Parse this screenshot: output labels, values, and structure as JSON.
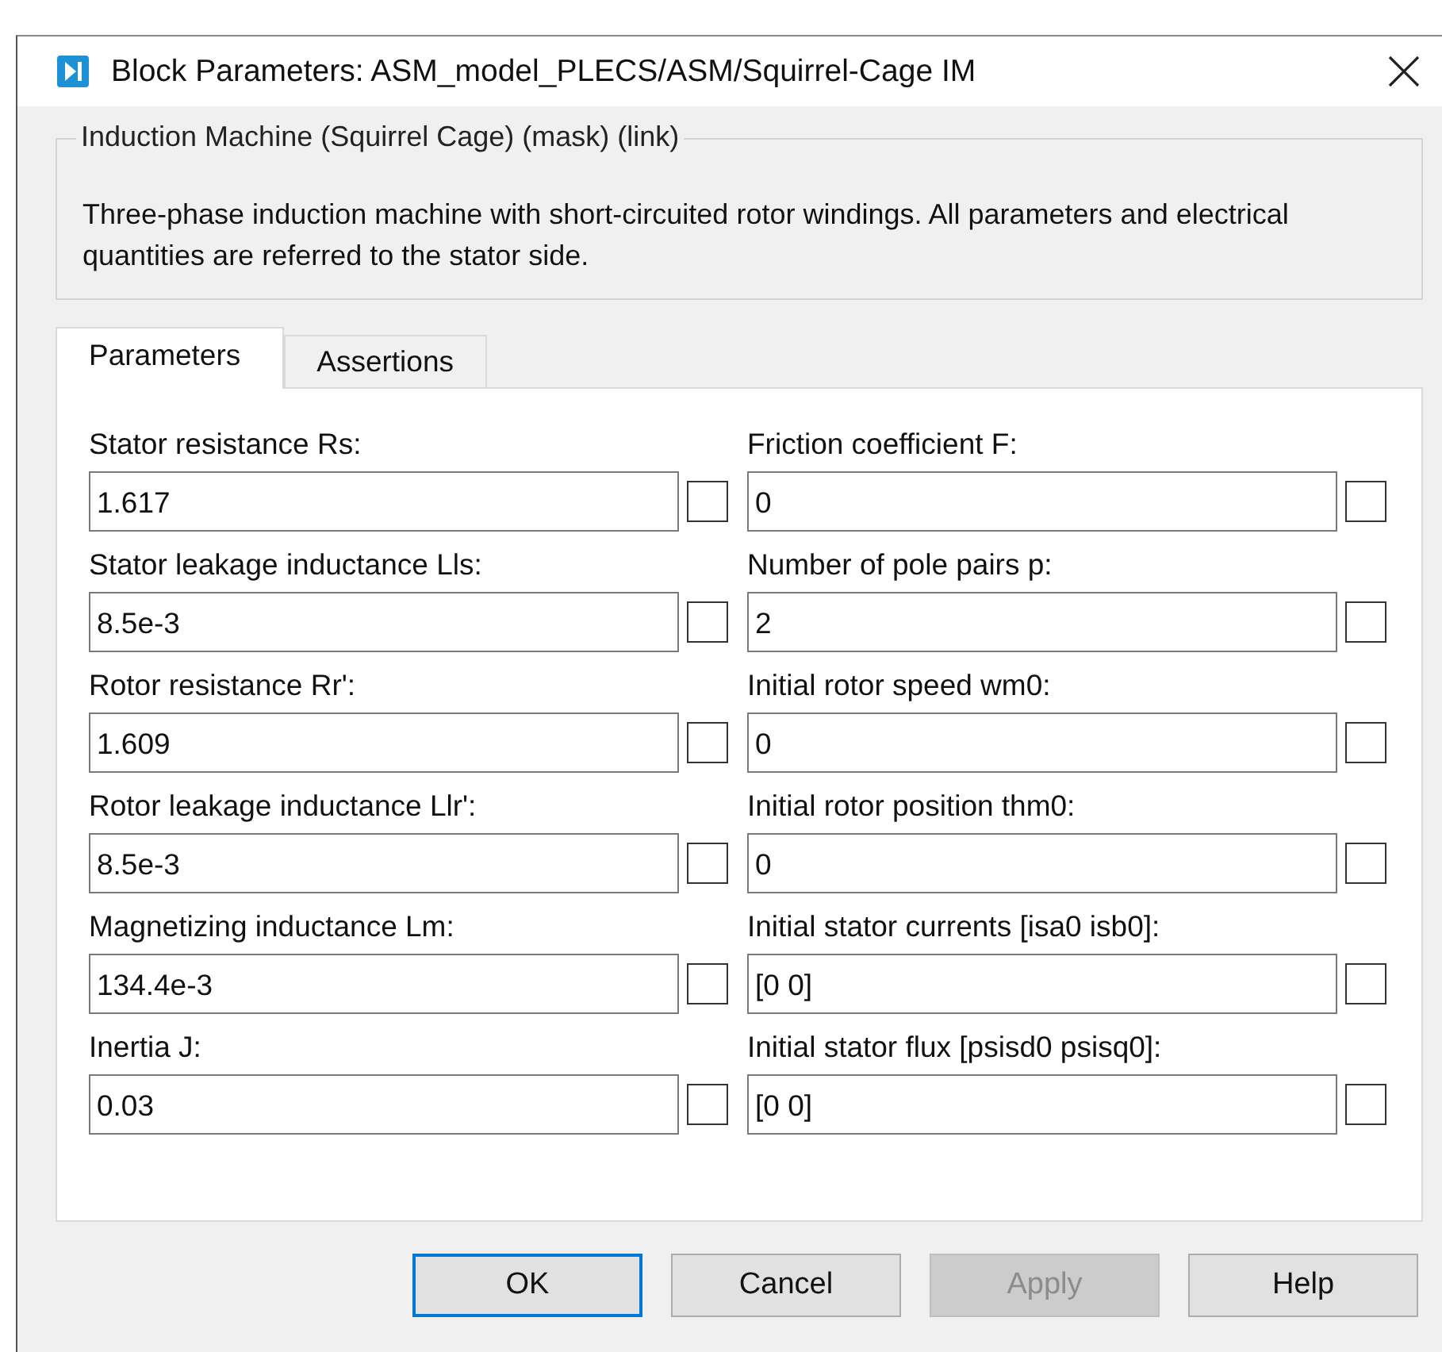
{
  "window": {
    "title": "Block Parameters: ASM_model_PLECS/ASM/Squirrel-Cage IM"
  },
  "group": {
    "title": "Induction Machine (Squirrel Cage) (mask) (link)",
    "description": "Three-phase induction machine with short-circuited rotor windings. All parameters and electrical quantities are referred to the stator side."
  },
  "tabs": [
    {
      "label": "Parameters",
      "selected": true
    },
    {
      "label": "Assertions",
      "selected": false
    }
  ],
  "parameters": [
    {
      "label": "Stator resistance Rs:",
      "value": "1.617",
      "checked": false
    },
    {
      "label": "Friction coefficient F:",
      "value": "0",
      "checked": false
    },
    {
      "label": "Stator leakage inductance Lls:",
      "value": "8.5e-3",
      "checked": false
    },
    {
      "label": "Number of pole pairs p:",
      "value": "2",
      "checked": false
    },
    {
      "label": "Rotor resistance Rr':",
      "value": "1.609",
      "checked": false
    },
    {
      "label": "Initial rotor speed wm0:",
      "value": "0",
      "checked": false
    },
    {
      "label": "Rotor leakage inductance Llr':",
      "value": "8.5e-3",
      "checked": false
    },
    {
      "label": "Initial rotor position thm0:",
      "value": "0",
      "checked": false
    },
    {
      "label": "Magnetizing inductance Lm:",
      "value": "134.4e-3",
      "checked": false
    },
    {
      "label": "Initial stator currents [isa0 isb0]:",
      "value": "[0 0]",
      "checked": false
    },
    {
      "label": "Inertia J:",
      "value": "0.03",
      "checked": false
    },
    {
      "label": "Initial stator flux [psisd0 psisq0]:",
      "value": "[0 0]",
      "checked": false
    }
  ],
  "buttons": [
    {
      "label": "OK",
      "default": true,
      "disabled": false
    },
    {
      "label": "Cancel",
      "default": false,
      "disabled": false
    },
    {
      "label": "Apply",
      "default": false,
      "disabled": true
    },
    {
      "label": "Help",
      "default": false,
      "disabled": false
    }
  ]
}
